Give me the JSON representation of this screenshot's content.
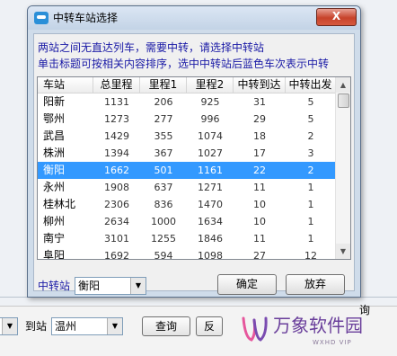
{
  "dialog": {
    "title": "中转车站选择",
    "close_label": "X",
    "info_line1": "两站之间无直达列车，需要中转，请选择中转站",
    "info_line2": "单击标题可按相关内容排序，选中中转站后蓝色车次表示中转"
  },
  "table": {
    "columns": [
      "车站",
      "总里程",
      "里程1",
      "里程2",
      "中转到达",
      "中转出发"
    ],
    "rows": [
      [
        "阳新",
        "1131",
        "206",
        "925",
        "31",
        "5"
      ],
      [
        "鄂州",
        "1273",
        "277",
        "996",
        "29",
        "5"
      ],
      [
        "武昌",
        "1429",
        "355",
        "1074",
        "18",
        "2"
      ],
      [
        "株洲",
        "1394",
        "367",
        "1027",
        "17",
        "3"
      ],
      [
        "衡阳",
        "1662",
        "501",
        "1161",
        "22",
        "2"
      ],
      [
        "永州",
        "1908",
        "637",
        "1271",
        "11",
        "1"
      ],
      [
        "桂林北",
        "2306",
        "836",
        "1470",
        "10",
        "1"
      ],
      [
        "柳州",
        "2634",
        "1000",
        "1634",
        "10",
        "1"
      ],
      [
        "南宁",
        "3101",
        "1255",
        "1846",
        "11",
        "1"
      ],
      [
        "阜阳",
        "1692",
        "594",
        "1098",
        "27",
        "12"
      ]
    ],
    "selected_index": 4
  },
  "controls": {
    "transfer_label": "中转站",
    "transfer_value": "衡阳",
    "ok_label": "确定",
    "cancel_label": "放弃"
  },
  "background": {
    "to_station_label": "到站",
    "to_station_value": "温州",
    "query_label": "查询",
    "reverse_label": "反",
    "partial_text": "询"
  },
  "watermark": {
    "brand": "万象软件园",
    "sub": "WXHD VIP"
  }
}
